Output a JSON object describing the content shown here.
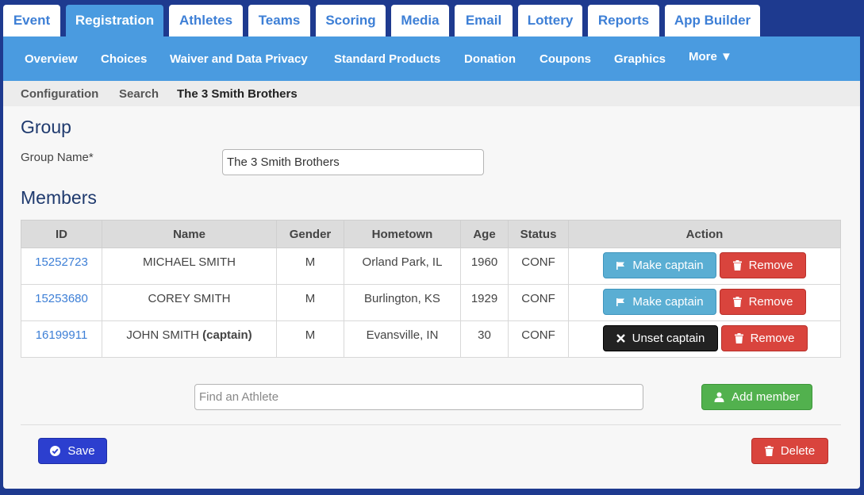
{
  "top_tabs": [
    {
      "label": "Event"
    },
    {
      "label": "Registration"
    },
    {
      "label": "Athletes"
    },
    {
      "label": "Teams"
    },
    {
      "label": "Scoring"
    },
    {
      "label": "Media"
    },
    {
      "label": "Email"
    },
    {
      "label": "Lottery"
    },
    {
      "label": "Reports"
    },
    {
      "label": "App Builder"
    }
  ],
  "active_tab": "Registration",
  "subnav": [
    {
      "label": "Overview"
    },
    {
      "label": "Choices"
    },
    {
      "label": "Waiver and Data Privacy"
    },
    {
      "label": "Standard Products"
    },
    {
      "label": "Donation"
    },
    {
      "label": "Coupons"
    },
    {
      "label": "Graphics"
    },
    {
      "label": "More ▼"
    }
  ],
  "breadcrumb": [
    "Configuration",
    "Search",
    "The 3 Smith Brothers"
  ],
  "group": {
    "heading": "Group",
    "name_label": "Group Name*",
    "name_value": "The 3 Smith Brothers"
  },
  "members": {
    "heading": "Members",
    "columns": [
      "ID",
      "Name",
      "Gender",
      "Hometown",
      "Age",
      "Status",
      "Action"
    ],
    "rows": [
      {
        "id": "15252723",
        "name": "MICHAEL SMITH",
        "captain_tag": "",
        "gender": "M",
        "hometown": "Orland Park, IL",
        "age": "1960",
        "status": "CONF",
        "primary_action": "Make captain",
        "remove": "Remove"
      },
      {
        "id": "15253680",
        "name": "COREY SMITH",
        "captain_tag": "",
        "gender": "M",
        "hometown": "Burlington, KS",
        "age": "1929",
        "status": "CONF",
        "primary_action": "Make captain",
        "remove": "Remove"
      },
      {
        "id": "16199911",
        "name": "JOHN SMITH",
        "captain_tag": "(captain)",
        "gender": "M",
        "hometown": "Evansville, IN",
        "age": "30",
        "status": "CONF",
        "primary_action": "Unset captain",
        "remove": "Remove"
      }
    ]
  },
  "find_athlete": {
    "placeholder": "Find an Athlete",
    "value": ""
  },
  "add_member_label": "Add member",
  "save_label": "Save",
  "delete_label": "Delete",
  "colors": {
    "page_bg": "#1e3a8f",
    "tab_active": "#4a9be0",
    "link": "#3d7fd6",
    "info": "#5aaed3",
    "danger": "#d9443d",
    "success": "#52b14e",
    "primary": "#2c3fcf"
  }
}
